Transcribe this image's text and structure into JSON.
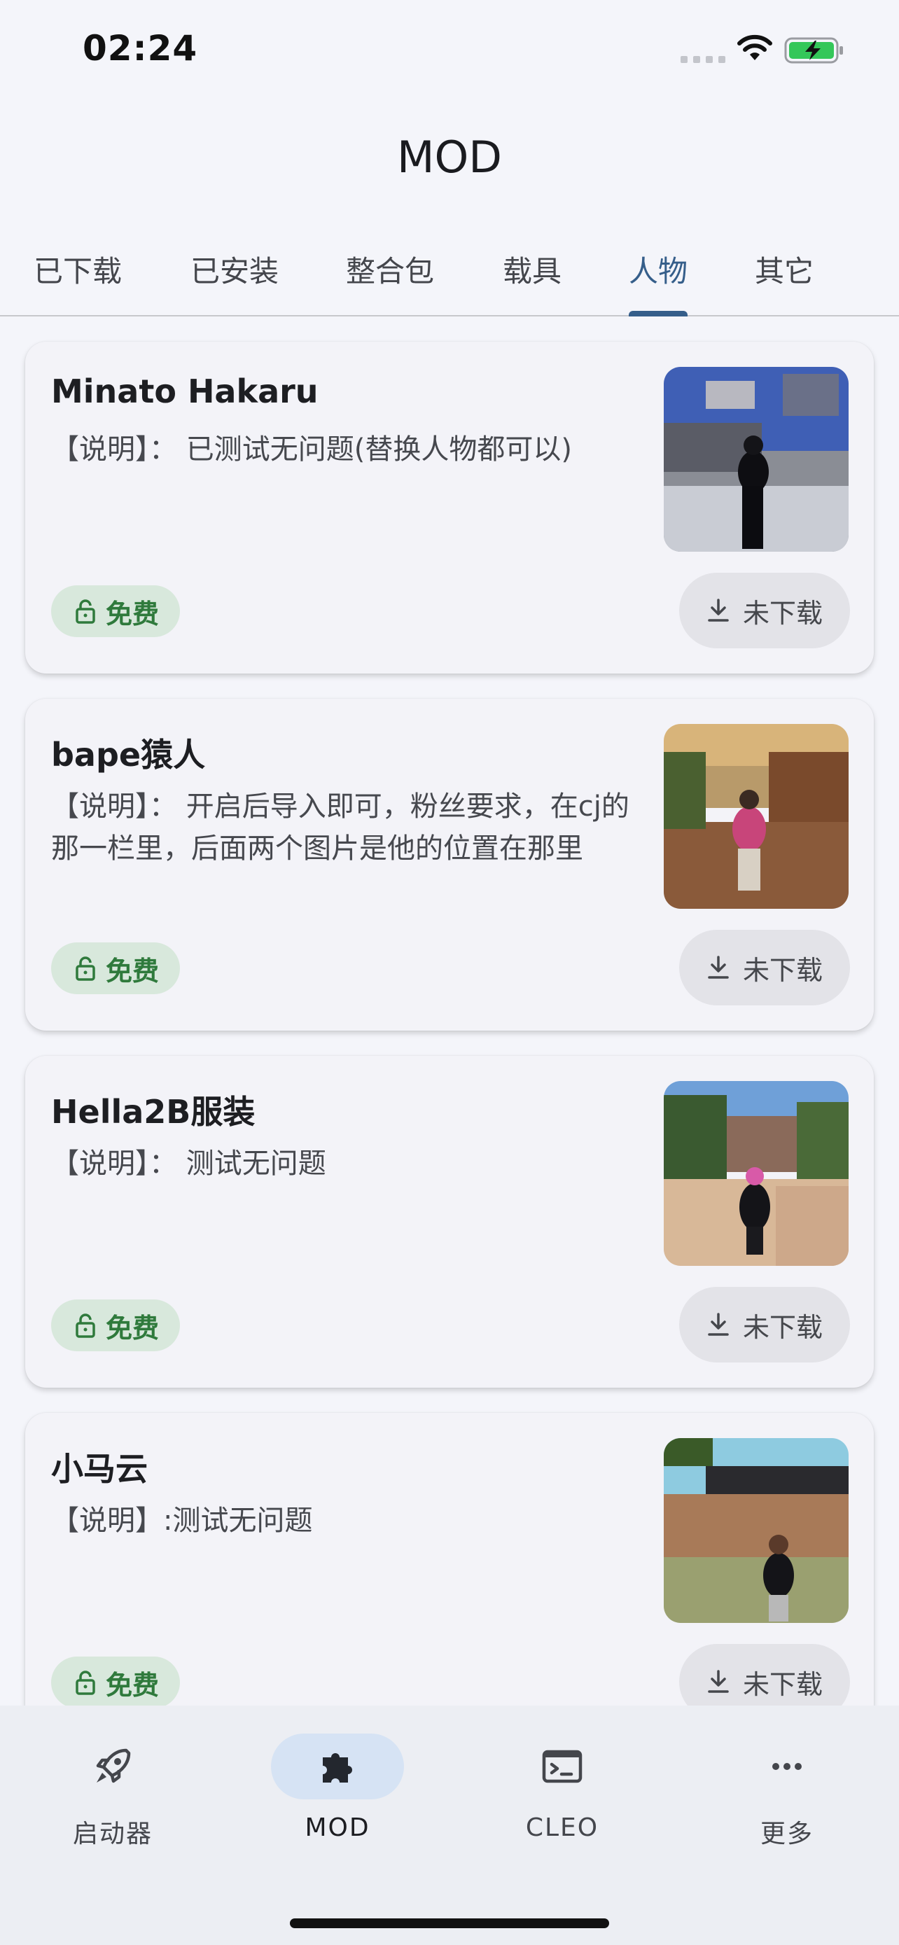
{
  "status_bar": {
    "time": "02:24"
  },
  "app_bar": {
    "title": "MOD"
  },
  "tabs": [
    {
      "label": "已下载"
    },
    {
      "label": "已安装"
    },
    {
      "label": "整合包"
    },
    {
      "label": "载具"
    },
    {
      "label": "人物",
      "active": true
    },
    {
      "label": "其它"
    }
  ],
  "items": [
    {
      "title": "Minato Hakaru",
      "description": "【说明】： 已测试无问题(替换人物都可以)",
      "price": "免费",
      "download_status": "未下载",
      "thumb_name": "minato-hakaru-thumbnail"
    },
    {
      "title": "bape猿人",
      "description": "【说明】： 开启后导入即可，粉丝要求，在cj的那一栏里，后面两个图片是他的位置在那里",
      "price": "免费",
      "download_status": "未下载",
      "thumb_name": "bape-thumbnail"
    },
    {
      "title": "Hella2B服装",
      "description": "【说明】： 测试无问题",
      "price": "免费",
      "download_status": "未下载",
      "thumb_name": "hella2b-thumbnail"
    },
    {
      "title": "小马云",
      "description": "【说明】:测试无问题",
      "price": "免费",
      "download_status": "未下载",
      "thumb_name": "xiaomayun-thumbnail"
    }
  ],
  "bottom_nav": [
    {
      "label": "启动器",
      "icon": "rocket-icon"
    },
    {
      "label": "MOD",
      "icon": "puzzle-icon",
      "active": true
    },
    {
      "label": "CLEO",
      "icon": "terminal-icon"
    },
    {
      "label": "更多",
      "icon": "more-horizontal-icon"
    }
  ],
  "colors": {
    "accent": "#355e8a",
    "free_badge_bg": "#d8e8dc",
    "free_badge_text": "#2f7a3c",
    "nav_active_bg": "#d6e3f4"
  }
}
